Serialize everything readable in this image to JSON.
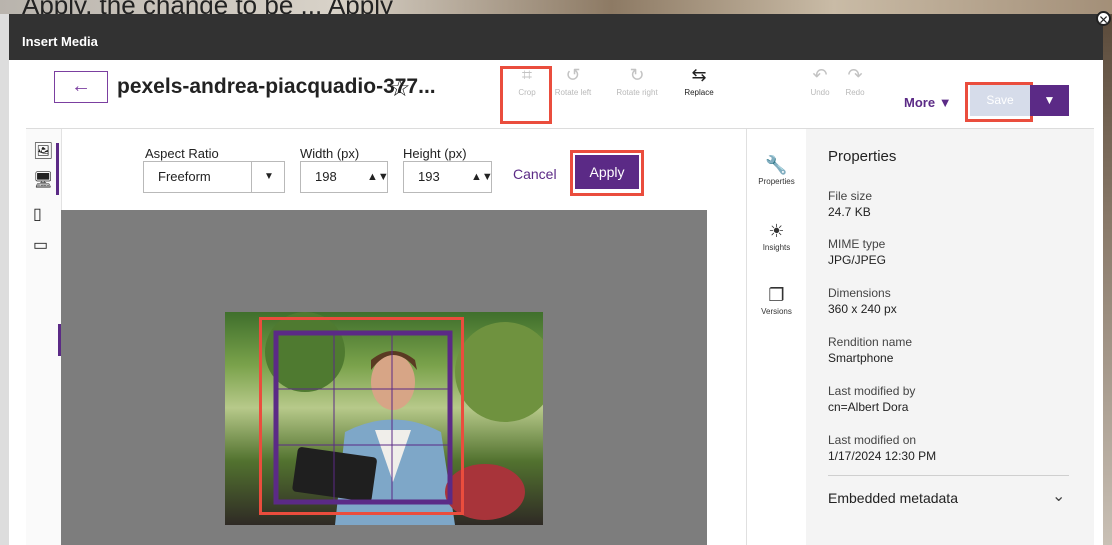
{
  "background": {
    "overlay_text": "Apply, the change to be ... Apply"
  },
  "dialog": {
    "title": "Insert Media",
    "close_icon": "close-circle-icon"
  },
  "header": {
    "filename": "pexels-andrea-piacquadio-377...",
    "tools": [
      {
        "label": "Crop",
        "icon": "crop-icon"
      },
      {
        "label": "Rotate left",
        "icon": "rotate-left-icon"
      },
      {
        "label": "Rotate right",
        "icon": "rotate-right-icon"
      },
      {
        "label": "Replace",
        "icon": "replace-icon"
      },
      {
        "label": "Undo",
        "icon": "undo-icon"
      },
      {
        "label": "Redo",
        "icon": "redo-icon"
      }
    ],
    "more_label": "More",
    "save_label": "Save"
  },
  "crop": {
    "aspect_label": "Aspect Ratio",
    "aspect_value": "Freeform",
    "width_label": "Width (px)",
    "width_value": "198",
    "height_label": "Height (px)",
    "height_value": "193",
    "cancel_label": "Cancel",
    "apply_label": "Apply"
  },
  "sidebar": {
    "tabs": [
      {
        "label": "Properties",
        "icon": "wrench-icon"
      },
      {
        "label": "Insights",
        "icon": "sun-icon"
      },
      {
        "label": "Versions",
        "icon": "versions-icon"
      }
    ],
    "heading": "Properties",
    "fields": [
      {
        "key": "File size",
        "value": "24.7 KB"
      },
      {
        "key": "MIME type",
        "value": "JPG/JPEG"
      },
      {
        "key": "Dimensions",
        "value": "360 x 240 px"
      },
      {
        "key": "Rendition name",
        "value": "Smartphone"
      },
      {
        "key": "Last modified by",
        "value": "cn=Albert Dora"
      },
      {
        "key": "Last modified on",
        "value": "1/17/2024 12:30 PM"
      }
    ],
    "embedded_label": "Embedded metadata"
  },
  "colors": {
    "accent": "#5b2a86",
    "highlight": "#ea4d3d",
    "titlebar": "#323232"
  }
}
